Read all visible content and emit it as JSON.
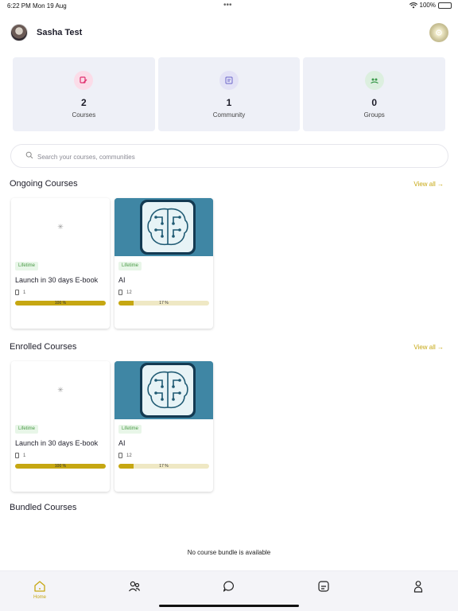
{
  "status_bar": {
    "time": "6:22 PM",
    "date": "Mon 19 Aug",
    "battery": "100%"
  },
  "header": {
    "user_name": "Sasha Test"
  },
  "stats": [
    {
      "value": "2",
      "label": "Courses",
      "icon": "courses-icon",
      "color": "#e0306e"
    },
    {
      "value": "1",
      "label": "Community",
      "icon": "community-icon",
      "color": "#6b66c9"
    },
    {
      "value": "0",
      "label": "Groups",
      "icon": "groups-icon",
      "color": "#3c9a4c"
    }
  ],
  "search": {
    "placeholder": "Search your courses, communities"
  },
  "ongoing": {
    "title": "Ongoing Courses",
    "view_all": "View all →",
    "courses": [
      {
        "tag": "Lifetime",
        "title": "Launch in 30 days E-book",
        "lessons": "1",
        "progress": 100,
        "progress_label": "100 %"
      },
      {
        "tag": "Lifetime",
        "title": "AI",
        "lessons": "12",
        "progress": 17,
        "progress_label": "17 %"
      }
    ]
  },
  "enrolled": {
    "title": "Enrolled Courses",
    "view_all": "View all →",
    "courses": [
      {
        "tag": "Lifetime",
        "title": "Launch in 30 days E-book",
        "lessons": "1",
        "progress": 100,
        "progress_label": "100 %"
      },
      {
        "tag": "Lifetime",
        "title": "AI",
        "lessons": "12",
        "progress": 17,
        "progress_label": "17 %"
      }
    ]
  },
  "bundled": {
    "title": "Bundled Courses",
    "empty_message": "No course bundle is available"
  },
  "tab_bar": {
    "home_label": "Home",
    "accent": "#c6a712"
  }
}
